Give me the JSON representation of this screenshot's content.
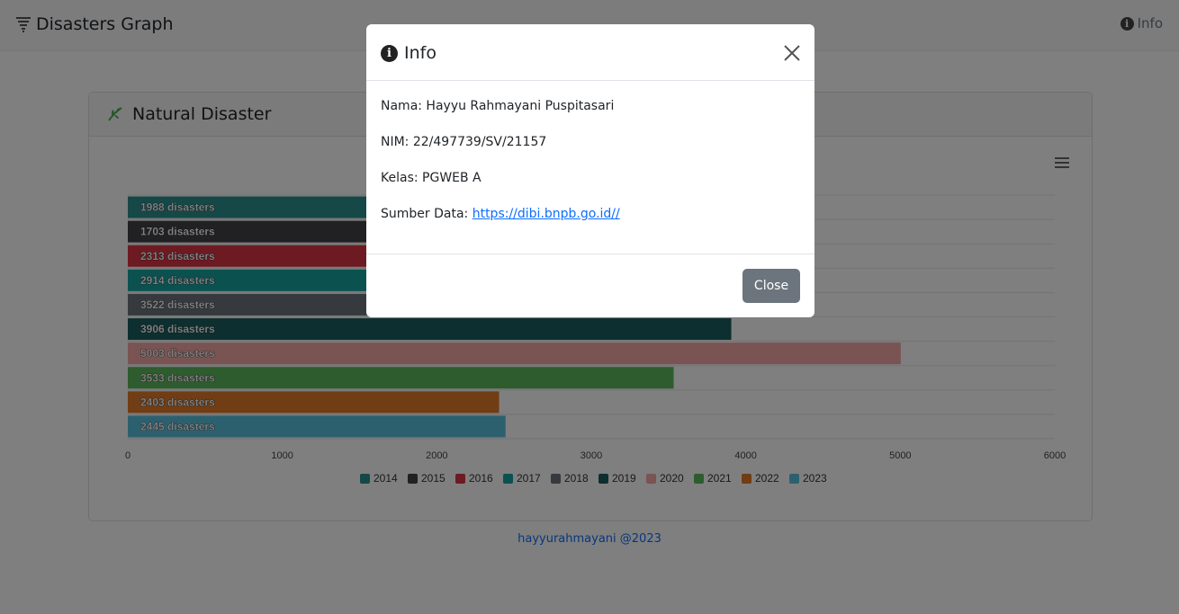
{
  "navbar": {
    "title": "Disasters Graph",
    "info_label": "Info"
  },
  "card": {
    "title": "Natural Disaster",
    "icon": "leaf-icon"
  },
  "chart_data": {
    "type": "bar",
    "orientation": "horizontal",
    "title": "",
    "categories": [
      "2014",
      "2015",
      "2016",
      "2017",
      "2018",
      "2019",
      "2020",
      "2021",
      "2022",
      "2023"
    ],
    "values": [
      1988,
      1703,
      2313,
      2914,
      3522,
      3906,
      5003,
      3533,
      2403,
      2445
    ],
    "data_labels": [
      "1988 disasters",
      "1703 disasters",
      "2313 disasters",
      "2914 disasters",
      "3522 disasters",
      "3906 disasters",
      "5003 disasters",
      "3533 disasters",
      "2403 disasters",
      "2445 disasters"
    ],
    "colors": [
      "#2b908f",
      "#434348",
      "#dc3545",
      "#17a2a0",
      "#6c757d",
      "#1b5f61",
      "#f4a7a7",
      "#5cb85c",
      "#e07b28",
      "#5bc0de"
    ],
    "xlim": [
      0,
      6000
    ],
    "xticks": [
      "0",
      "1000",
      "2000",
      "3000",
      "4000",
      "5000",
      "6000"
    ],
    "legend": [
      "2014",
      "2015",
      "2016",
      "2017",
      "2018",
      "2019",
      "2020",
      "2021",
      "2022",
      "2023"
    ],
    "legend_position": "bottom",
    "grid": true
  },
  "footer": {
    "text": "hayyurahmayani @2023"
  },
  "modal": {
    "title": "Info",
    "lines": [
      "Nama: Hayyu Rahmayani Puspitasari",
      "NIM: 22/497739/SV/21157",
      "Kelas: PGWEB A"
    ],
    "source_label": "Sumber Data: ",
    "source_link": "https://dibi.bnpb.go.id//",
    "close_button": "Close"
  }
}
